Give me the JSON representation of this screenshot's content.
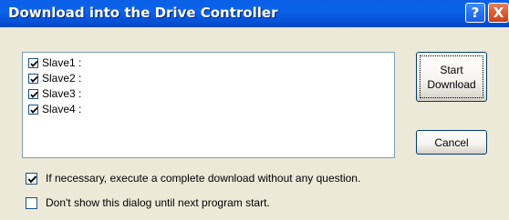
{
  "window": {
    "title": "Download into the Drive Controller",
    "help_glyph": "?",
    "close_glyph": "X"
  },
  "slaves": [
    {
      "label": "Slave1 :",
      "checked": true
    },
    {
      "label": "Slave2 :",
      "checked": true
    },
    {
      "label": "Slave3 :",
      "checked": true
    },
    {
      "label": "Slave4 :",
      "checked": true
    }
  ],
  "buttons": {
    "start_line1": "Start",
    "start_line2": "Download",
    "cancel": "Cancel"
  },
  "options": {
    "complete_download": {
      "label": "If necessary, execute a complete download without any question.",
      "checked": true
    },
    "dont_show": {
      "label": "Don't show this dialog until next program start.",
      "checked": false
    }
  },
  "colors": {
    "titlebar": "#0a5fe6",
    "dialog_bg": "#ece9d8",
    "close_button": "#df5b30"
  }
}
